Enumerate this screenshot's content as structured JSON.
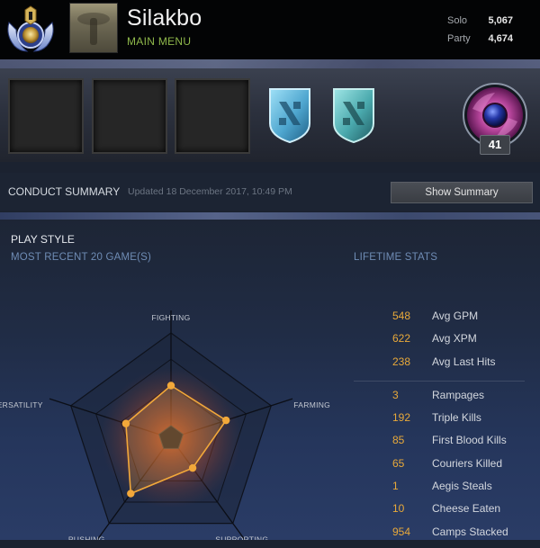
{
  "header": {
    "player_name": "Silakbo",
    "menu_label": "MAIN MENU",
    "rank_medal_icon": "rank-medal-icon",
    "mmr": [
      {
        "label": "Solo",
        "value": "5,067"
      },
      {
        "label": "Party",
        "value": "4,674"
      }
    ]
  },
  "showcase": {
    "slots": [
      "empty",
      "empty",
      "empty"
    ],
    "shields": [
      "dota-shield-icon",
      "dota-shield-icon"
    ],
    "level": "41",
    "accent_colors": {
      "shield1": "#5fb3d9",
      "shield2": "#4fb2b8",
      "orb": "#b5449a"
    }
  },
  "conduct": {
    "title": "CONDUCT SUMMARY",
    "updated": "Updated 18 December 2017, 10:49 PM",
    "button_label": "Show Summary"
  },
  "playstyle": {
    "title": "PLAY STYLE",
    "recent_label": "MOST RECENT 20 GAME(S)",
    "lifetime_label": "LIFETIME STATS",
    "axes": [
      "FIGHTING",
      "FARMING",
      "SUPPORTING",
      "PUSHING",
      "VERSATILITY"
    ],
    "values": [
      0.5,
      0.55,
      0.35,
      0.65,
      0.45
    ],
    "accent_color": "#f2a83a"
  },
  "stats": {
    "primary": [
      {
        "value": "548",
        "label": "Avg GPM"
      },
      {
        "value": "622",
        "label": "Avg XPM"
      },
      {
        "value": "238",
        "label": "Avg Last Hits"
      }
    ],
    "secondary": [
      {
        "value": "3",
        "label": "Rampages"
      },
      {
        "value": "192",
        "label": "Triple Kills"
      },
      {
        "value": "85",
        "label": "First Blood Kills"
      },
      {
        "value": "65",
        "label": "Couriers Killed"
      },
      {
        "value": "1",
        "label": "Aegis Steals"
      },
      {
        "value": "10",
        "label": "Cheese Eaten"
      },
      {
        "value": "954",
        "label": "Camps Stacked"
      }
    ]
  }
}
